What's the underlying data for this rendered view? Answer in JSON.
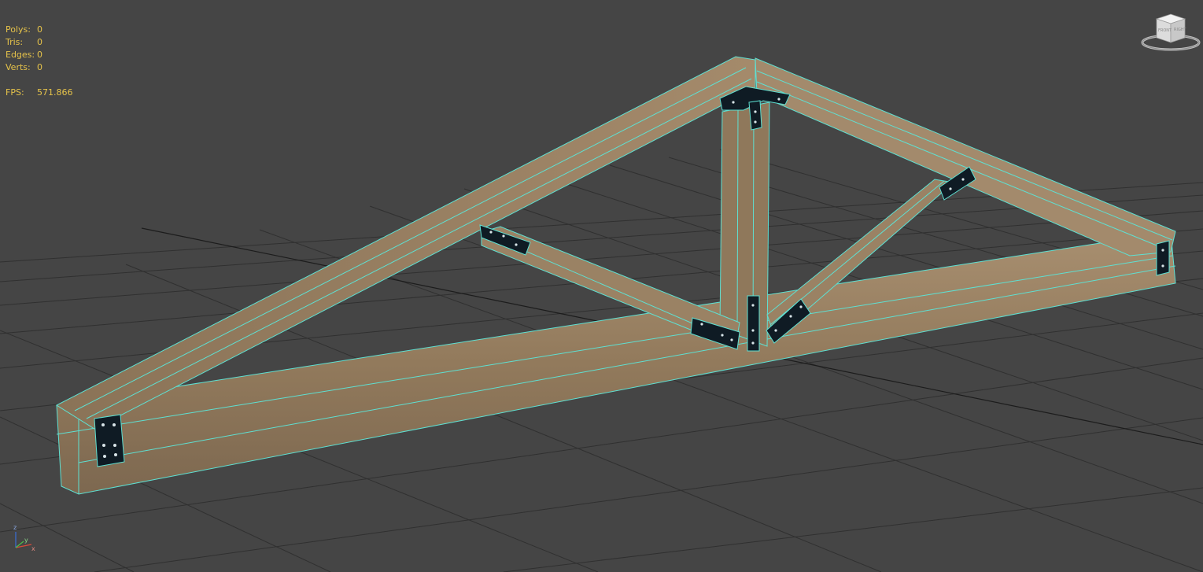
{
  "viewport": {
    "background_color": "#454545",
    "grid_color": "#2f2f2f",
    "grid_main_axis_color": "#1a1a1a"
  },
  "stats": {
    "polys_label": "Polys:",
    "polys_value": "0",
    "tris_label": "Tris:",
    "tris_value": "0",
    "edges_label": "Edges:",
    "edges_value": "0",
    "verts_label": "Verts:",
    "verts_value": "0",
    "fps_label": "FPS:",
    "fps_value": "571.866",
    "text_color": "#e6c34a"
  },
  "viewcube": {
    "front_label": "FRONT",
    "right_label": "RIGHT",
    "icon": "viewcube-icon"
  },
  "axis_gizmo": {
    "z_label": "z",
    "y_label": "y",
    "x_label": "x",
    "icon": "axis-tripod-icon"
  },
  "model": {
    "name_icon": "roof-truss-model",
    "wood_color": "#9c8466",
    "wire_color": "#5ee0d2",
    "plate_color": "#0f1b24"
  }
}
